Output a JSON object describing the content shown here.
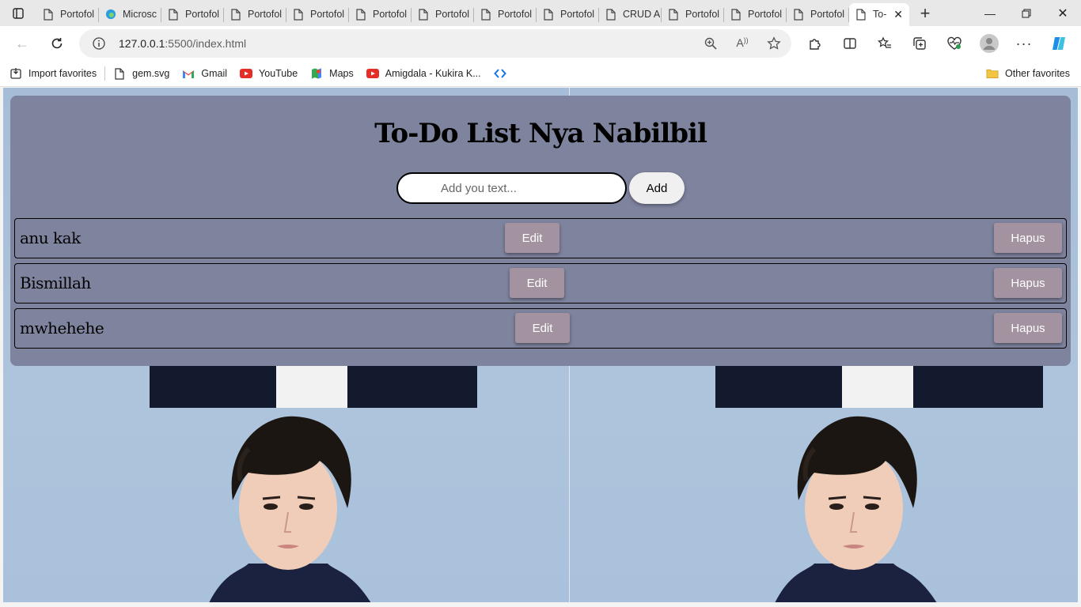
{
  "browser": {
    "tabs": [
      {
        "label": "Portofol",
        "icon": "page-icon"
      },
      {
        "label": "Microsc",
        "icon": "edge-icon"
      },
      {
        "label": "Portofol",
        "icon": "page-icon"
      },
      {
        "label": "Portofol",
        "icon": "page-icon"
      },
      {
        "label": "Portofol",
        "icon": "page-icon"
      },
      {
        "label": "Portofol",
        "icon": "page-icon"
      },
      {
        "label": "Portofol",
        "icon": "page-icon"
      },
      {
        "label": "Portofol",
        "icon": "page-icon"
      },
      {
        "label": "Portofol",
        "icon": "page-icon"
      },
      {
        "label": "CRUD A",
        "icon": "page-icon"
      },
      {
        "label": "Portofol",
        "icon": "page-icon"
      },
      {
        "label": "Portofol",
        "icon": "page-icon"
      },
      {
        "label": "Portofol",
        "icon": "page-icon"
      },
      {
        "label": "To-",
        "icon": "page-icon",
        "active": true
      }
    ],
    "address": {
      "host": "127.0.0.1",
      "path": ":5500/index.html"
    },
    "favorites": [
      {
        "label": "Import favorites",
        "icon": "import-icon"
      },
      {
        "label": "gem.svg",
        "icon": "page-icon"
      },
      {
        "label": "Gmail",
        "icon": "gmail-icon"
      },
      {
        "label": "YouTube",
        "icon": "youtube-icon"
      },
      {
        "label": "Maps",
        "icon": "maps-icon"
      },
      {
        "label": "Amigdala - Kukira K...",
        "icon": "youtube-icon"
      },
      {
        "label": "",
        "icon": "code-icon"
      }
    ],
    "other_favorites": "Other favorites"
  },
  "app": {
    "title": "To-Do List Nya Nabilbil",
    "input_placeholder": "Add you text...",
    "input_value": "",
    "add_label": "Add",
    "todos": [
      {
        "text": "anu kak",
        "edit_label": "Edit",
        "delete_label": "Hapus"
      },
      {
        "text": "Bismillah",
        "edit_label": "Edit",
        "delete_label": "Hapus"
      },
      {
        "text": "mwhehehe",
        "edit_label": "Edit",
        "delete_label": "Hapus"
      }
    ]
  },
  "colors": {
    "app_panel": "#7e839e",
    "button_bg": "#a393a0",
    "page_bg": "#a9c1db"
  }
}
